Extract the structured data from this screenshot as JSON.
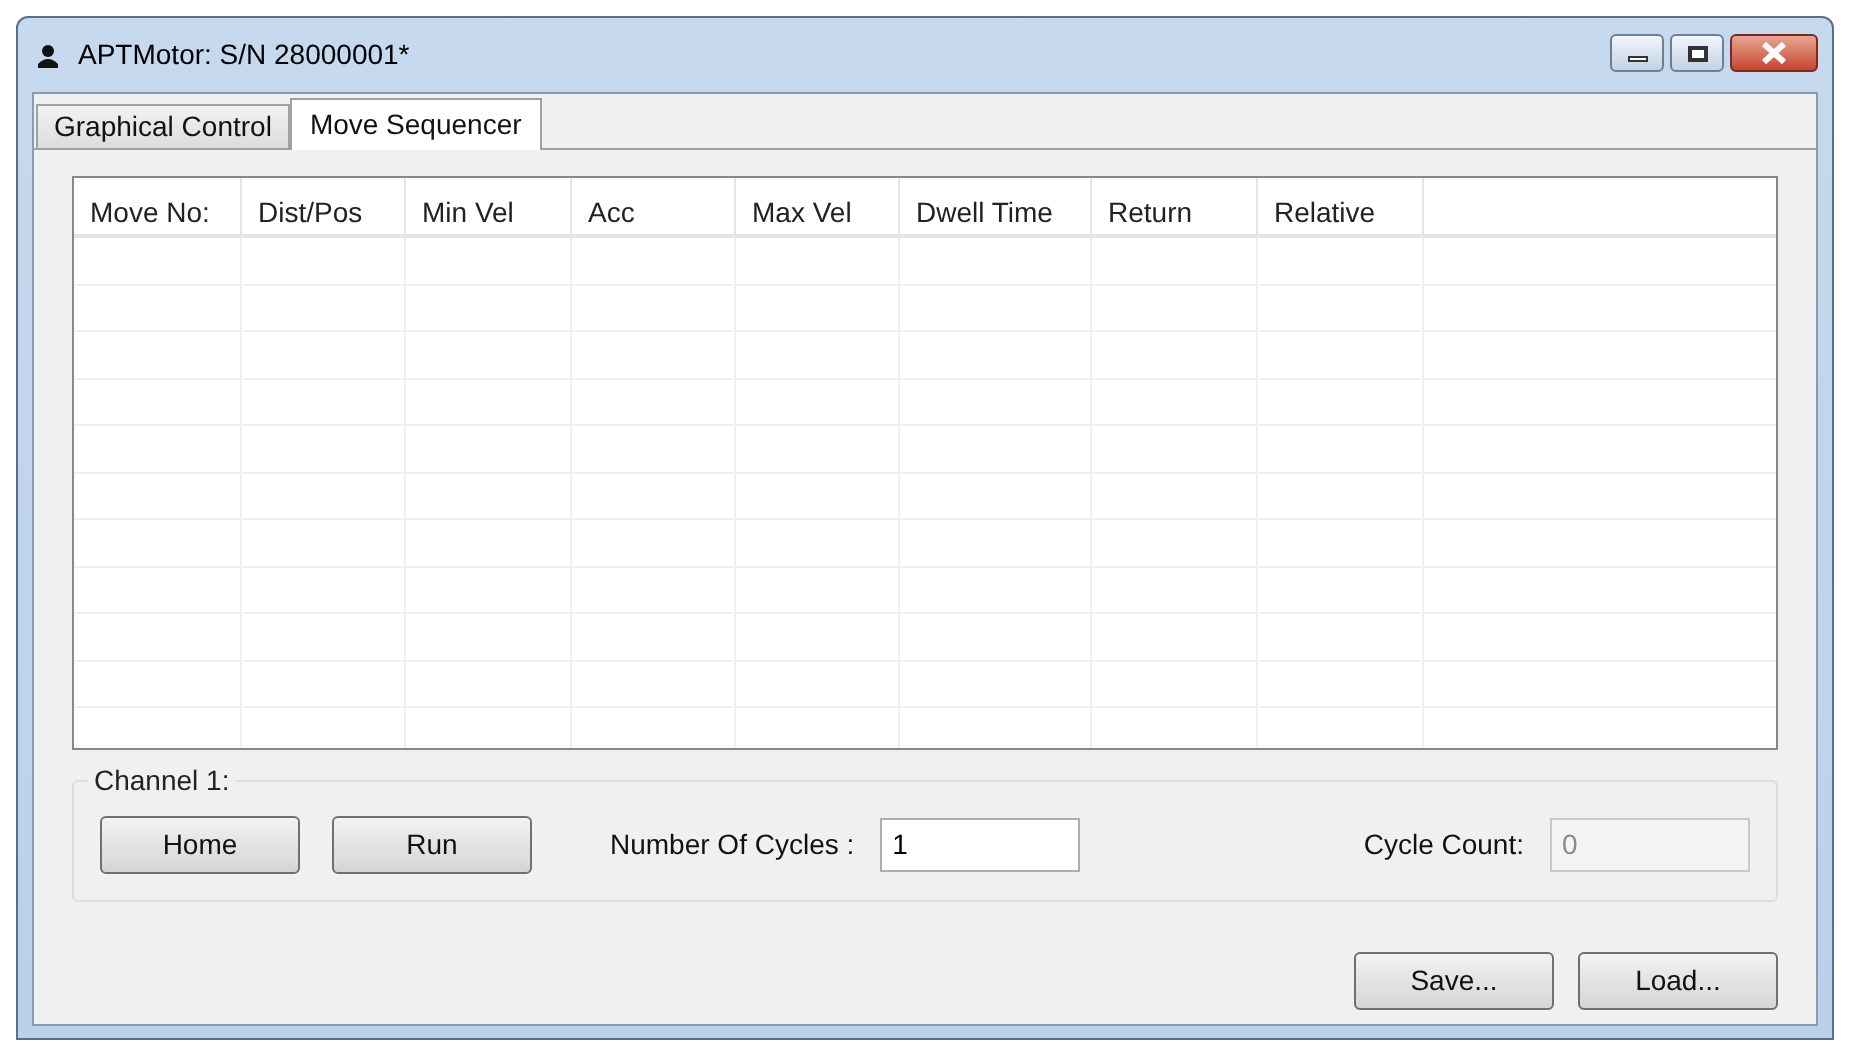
{
  "window": {
    "title": "APTMotor: S/N 28000001*"
  },
  "tabs": [
    {
      "label": "Graphical Control",
      "selected": false
    },
    {
      "label": "Move Sequencer",
      "selected": true
    }
  ],
  "table": {
    "columns": [
      "Move No:",
      "Dist/Pos",
      "Min Vel",
      "Acc",
      "Max Vel",
      "Dwell Time",
      "Return",
      "Relative"
    ]
  },
  "channel_group": {
    "title": "Channel 1:",
    "buttons": [
      "Home",
      "Run"
    ],
    "cycles": {
      "label": "Number Of Cycles :",
      "value": "1",
      "disabled": false
    },
    "cycle_count": {
      "label": "Cycle Count:",
      "value": "0",
      "disabled": true
    }
  },
  "footer_buttons": [
    "Save...",
    "Load..."
  ]
}
